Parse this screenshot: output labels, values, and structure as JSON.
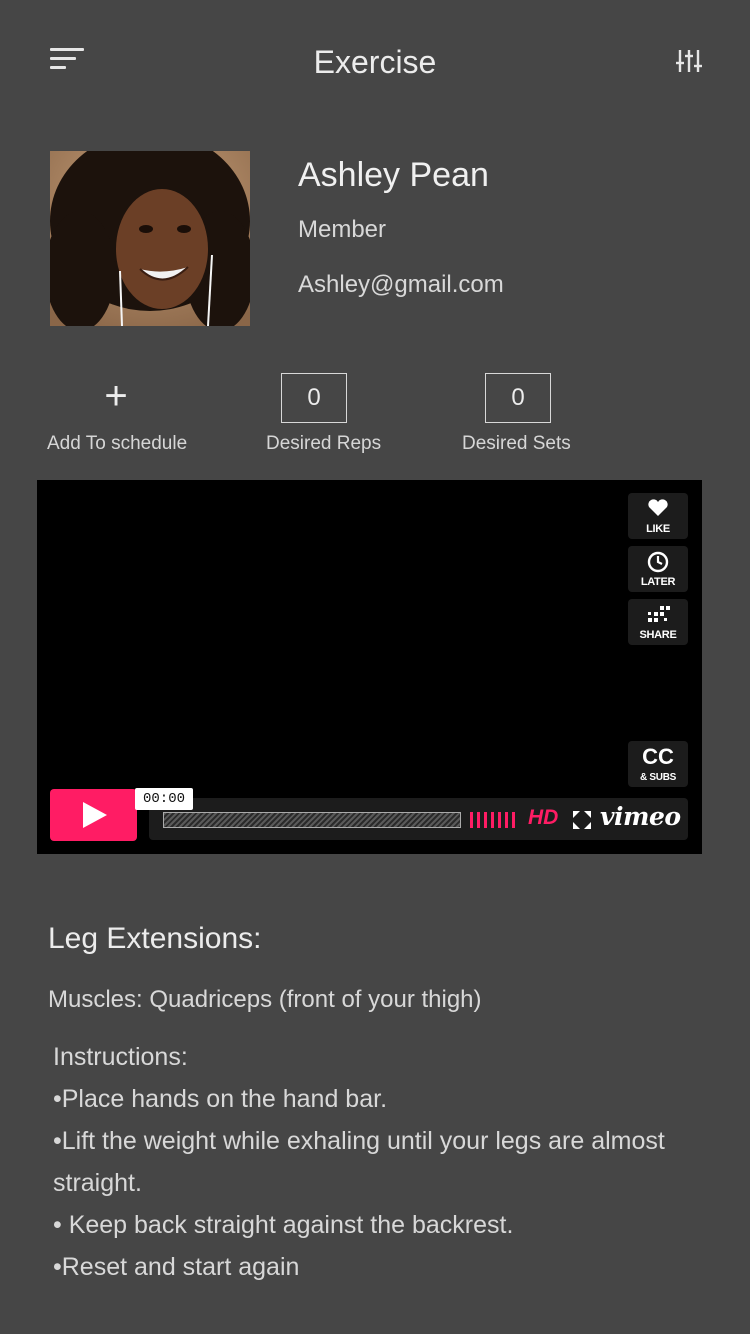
{
  "header": {
    "title": "Exercise",
    "menu_icon": "hamburger-menu-icon",
    "filter_icon": "sliders-icon"
  },
  "profile": {
    "name": "Ashley Pean",
    "role": "Member",
    "email": "Ashley@gmail.com"
  },
  "actions": {
    "add_label": "Add To schedule",
    "reps_value": "0",
    "reps_label": "Desired Reps",
    "sets_value": "0",
    "sets_label": "Desired Sets"
  },
  "video": {
    "like_label": "LIKE",
    "later_label": "LATER",
    "share_label": "SHARE",
    "cc_label": "CC",
    "subs_label": "& SUBS",
    "time": "00:00",
    "hd_label": "HD",
    "brand": "vimeo",
    "accent_color": "#ff1c64"
  },
  "exercise": {
    "title": "Leg Extensions:",
    "muscles": "Muscles: Quadriceps (front of your thigh)",
    "instructions_heading": "Instructions:",
    "steps": [
      "•Place hands on the hand bar.",
      "•Lift the weight while exhaling until your legs are almost straight.",
      "• Keep back straight against the backrest.",
      "•Reset and start again"
    ]
  }
}
